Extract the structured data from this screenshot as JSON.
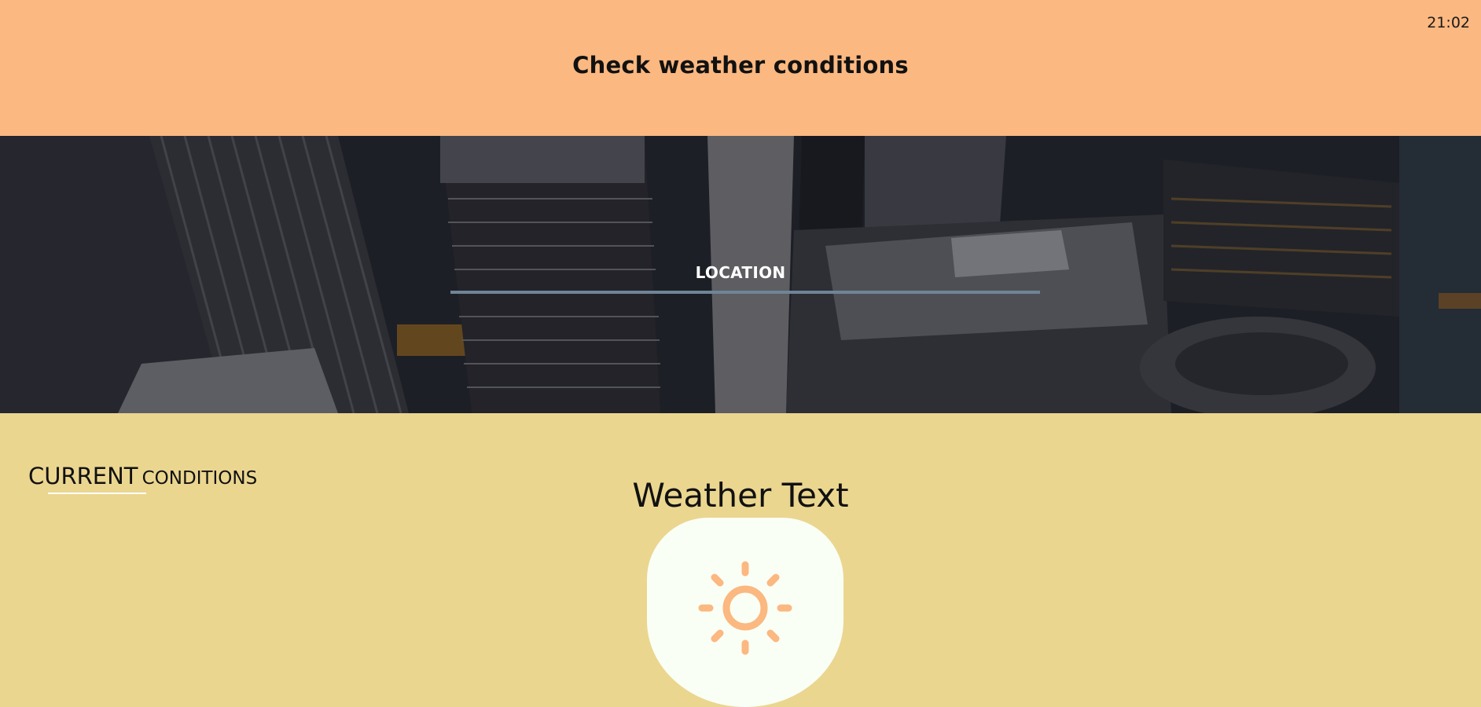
{
  "header": {
    "clock": "21:02",
    "title": "Check weather conditions"
  },
  "search": {
    "label": "LOCATION",
    "value": "",
    "placeholder": ""
  },
  "current": {
    "heading_part1": "CURRENT",
    "heading_part2": "CONDITIONS",
    "weather_text": "Weather Text",
    "icon": "sun-icon"
  },
  "colors": {
    "header_bg": "#fbb880",
    "content_bg": "#ebd690",
    "card_bg": "#f9fff5",
    "accent": "#fbb880",
    "input_line": "#6f8497"
  }
}
